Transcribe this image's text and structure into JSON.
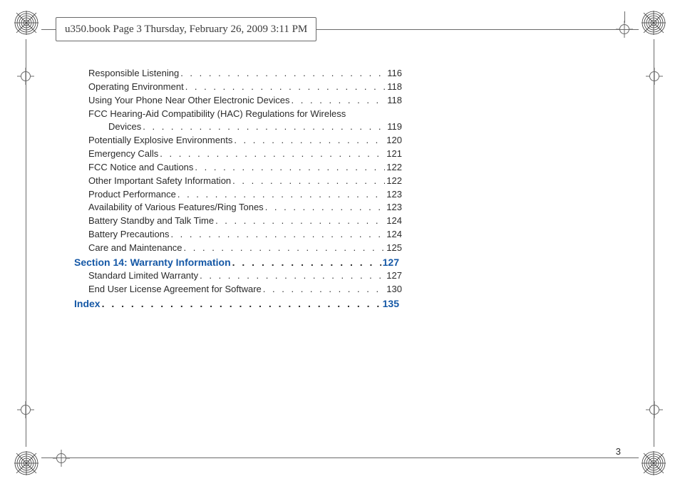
{
  "header": {
    "text": "u350.book  Page 3  Thursday, February 26, 2009  3:11 PM"
  },
  "folio": "3",
  "toc": [
    {
      "kind": "item",
      "title": "Responsible Listening",
      "page": "116"
    },
    {
      "kind": "item",
      "title": "Operating Environment",
      "page": "118"
    },
    {
      "kind": "item",
      "title": "Using Your Phone Near Other Electronic Devices",
      "page": "118"
    },
    {
      "kind": "item-wrap",
      "title1": "FCC Hearing-Aid Compatibility (HAC) Regulations for Wireless",
      "title2": "Devices",
      "page": "119"
    },
    {
      "kind": "item",
      "title": "Potentially Explosive Environments",
      "page": "120"
    },
    {
      "kind": "item",
      "title": "Emergency Calls",
      "page": "121"
    },
    {
      "kind": "item",
      "title": "FCC Notice and Cautions",
      "page": "122"
    },
    {
      "kind": "item",
      "title": "Other Important Safety Information",
      "page": "122"
    },
    {
      "kind": "item",
      "title": "Product Performance",
      "page": "123"
    },
    {
      "kind": "item",
      "title": "Availability of Various Features/Ring Tones",
      "page": "123"
    },
    {
      "kind": "item",
      "title": "Battery Standby and Talk Time",
      "page": "124"
    },
    {
      "kind": "item",
      "title": "Battery Precautions",
      "page": "124"
    },
    {
      "kind": "item",
      "title": "Care and Maintenance",
      "page": "125"
    },
    {
      "kind": "section",
      "title": "Section 14:  Warranty Information",
      "page": "127"
    },
    {
      "kind": "item",
      "title": "Standard Limited Warranty",
      "page": "127"
    },
    {
      "kind": "item",
      "title": "End User License Agreement for Software",
      "page": "130"
    },
    {
      "kind": "section",
      "title": "Index",
      "page": "135"
    }
  ]
}
